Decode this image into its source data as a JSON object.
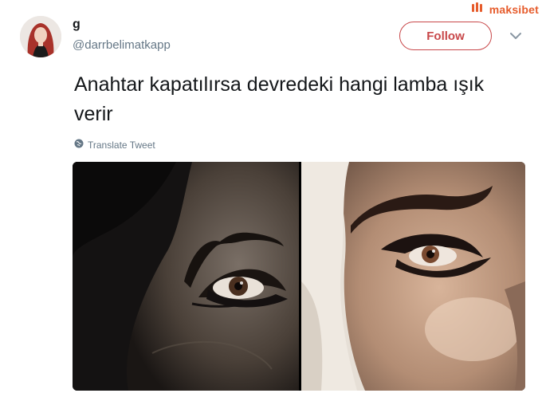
{
  "watermark": {
    "brand": "maksibet",
    "icon": "brand-logo-icon"
  },
  "tweet": {
    "display_name": "g",
    "handle": "@darrbelimatkapp",
    "follow_label": "Follow",
    "text": "Anahtar kapatılırsa devredeki hangi lamba ışık verir",
    "translate_label": "Translate Tweet"
  },
  "icons": {
    "menu": "chevron-down-icon",
    "translate": "globe-icon"
  },
  "colors": {
    "follow_accent": "#c8484a",
    "muted_text": "#657786",
    "watermark": "#e65c2c"
  }
}
